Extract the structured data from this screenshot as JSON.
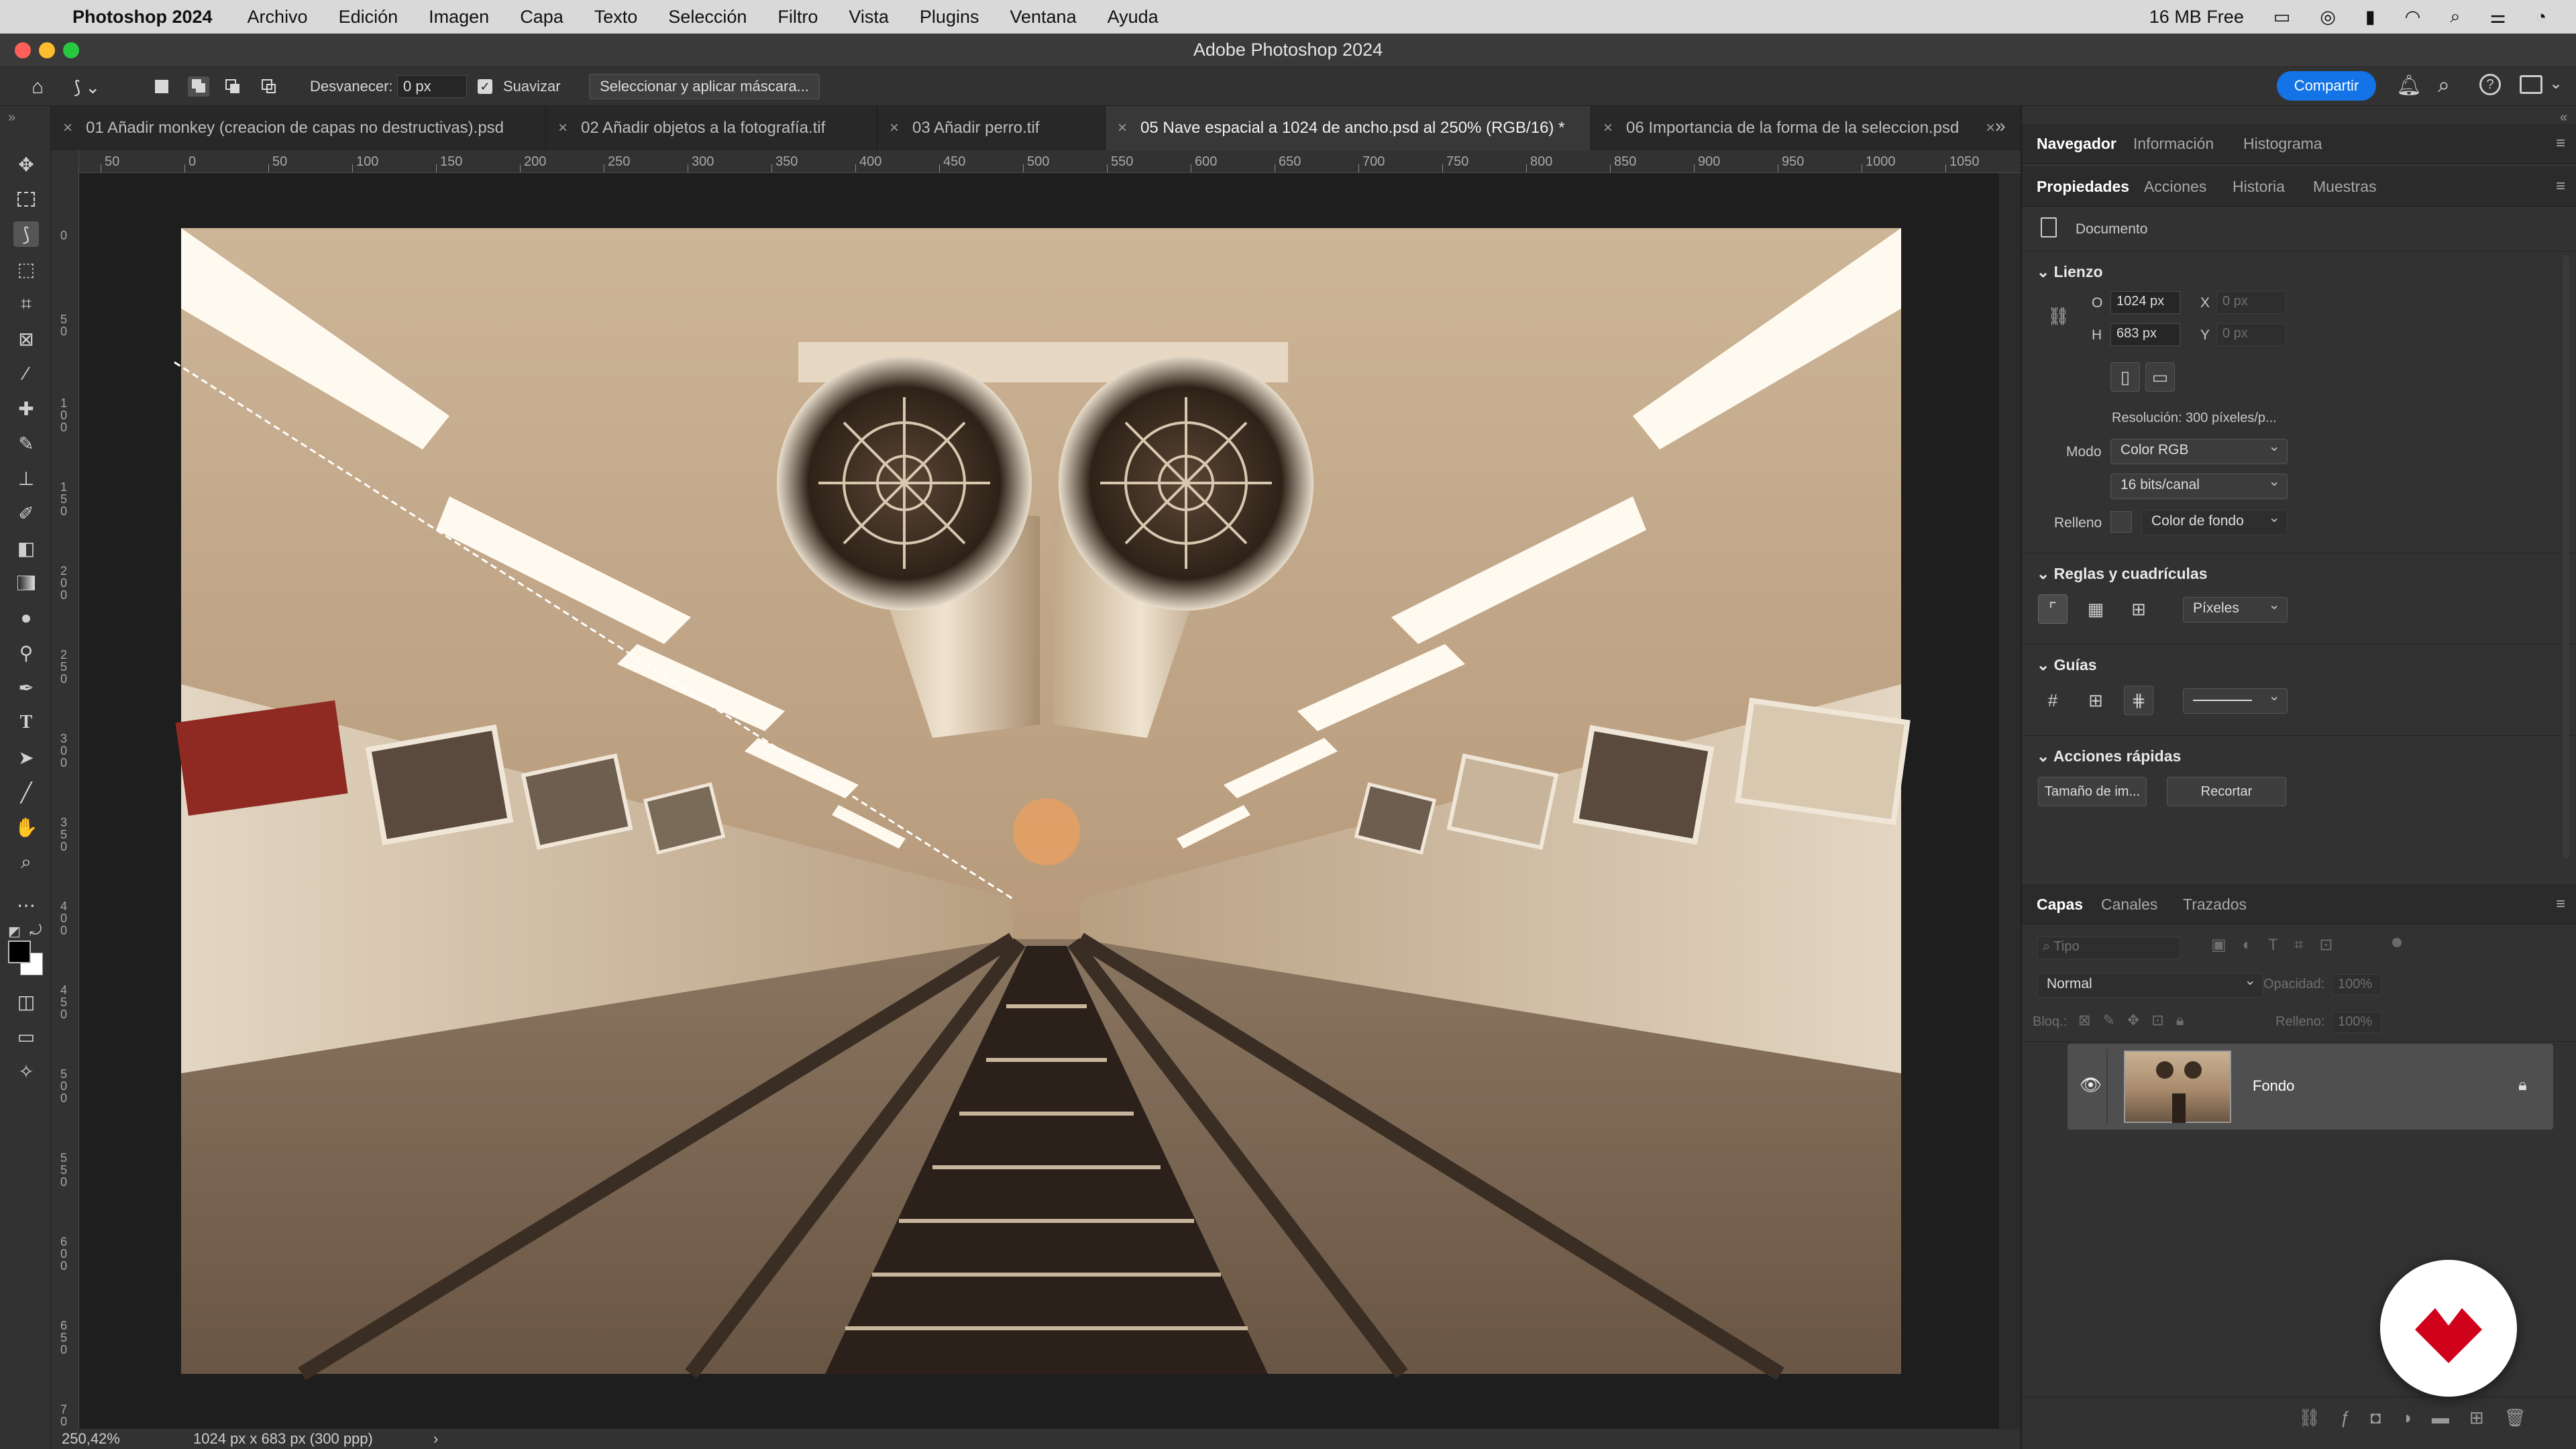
{
  "menubar": {
    "app_name": "Photoshop 2024",
    "items": [
      "Archivo",
      "Edición",
      "Imagen",
      "Capa",
      "Texto",
      "Selección",
      "Filtro",
      "Vista",
      "Plugins",
      "Ventana",
      "Ayuda"
    ],
    "memory": "16 MB Free"
  },
  "window": {
    "title": "Adobe Photoshop  2024"
  },
  "options_bar": {
    "feather_label": "Desvanecer:",
    "feather_value": "0 px",
    "antialias_label": "Suavizar",
    "antialias_checked": true,
    "mask_button": "Seleccionar y aplicar máscara...",
    "share_button": "Compartir"
  },
  "doc_tabs": [
    {
      "label": "01 Añadir monkey (creacion de capas no destructivas).psd",
      "active": false
    },
    {
      "label": "02 Añadir objetos a la fotografía.tif",
      "active": false
    },
    {
      "label": "03 Añadir perro.tif",
      "active": false
    },
    {
      "label": "05 Nave espacial a 1024 de ancho.psd al 250% (RGB/16) *",
      "active": true
    },
    {
      "label": "06 Importancia de la forma de la seleccion.psd",
      "active": false
    }
  ],
  "ruler": {
    "h_ticks": [
      "50",
      "0",
      "50",
      "100",
      "150",
      "200",
      "250",
      "300",
      "350",
      "400",
      "450",
      "500",
      "550",
      "600",
      "650",
      "700",
      "750",
      "800",
      "850",
      "900",
      "950",
      "1000",
      "1050"
    ],
    "v_ticks": [
      "0",
      "50",
      "100",
      "150",
      "200",
      "250",
      "300",
      "350",
      "400",
      "450",
      "500",
      "550",
      "600",
      "650",
      "700"
    ]
  },
  "status": {
    "zoom": "250,42%",
    "doc_info": "1024 px x 683 px (300 ppp)",
    "arrow": "›"
  },
  "panels_top": {
    "tabs": [
      "Navegador",
      "Información",
      "Histograma"
    ]
  },
  "properties": {
    "tabs": [
      "Propiedades",
      "Acciones",
      "Historia",
      "Muestras"
    ],
    "doc_label": "Documento",
    "canvas": {
      "title": "Lienzo",
      "w_label": "O",
      "w_value": "1024 px",
      "h_label": "H",
      "h_value": "683 px",
      "x_label": "X",
      "x_value": "0 px",
      "y_label": "Y",
      "y_value": "0 px",
      "resolution": "Resolución: 300 píxeles/p...",
      "mode_label": "Modo",
      "mode_value": "Color RGB",
      "depth_value": "16 bits/canal",
      "fill_label": "Relleno",
      "fill_value": "Color de fondo"
    },
    "rulers_grids": {
      "title": "Reglas y cuadrículas",
      "units": "Píxeles"
    },
    "guides": {
      "title": "Guías"
    },
    "quick_actions": {
      "title": "Acciones rápidas",
      "image_size": "Tamaño de im...",
      "crop": "Recortar"
    }
  },
  "layers": {
    "tabs": [
      "Capas",
      "Canales",
      "Trazados"
    ],
    "search_placeholder": "Tipo",
    "blend_mode": "Normal",
    "opacity_label": "Opacidad:",
    "opacity_value": "100%",
    "lock_label": "Bloq.:",
    "fill_label": "Relleno:",
    "fill_value": "100%",
    "items": [
      {
        "name": "Fondo",
        "visible": true,
        "locked": true
      }
    ]
  },
  "colors": {
    "accent": "#1473e6",
    "badge_red": "#d0021b"
  }
}
